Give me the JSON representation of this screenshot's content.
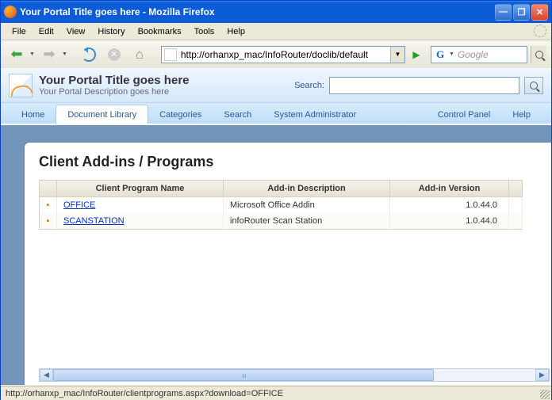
{
  "window": {
    "title": "Your Portal Title goes here - Mozilla Firefox"
  },
  "menu": {
    "items": [
      "File",
      "Edit",
      "View",
      "History",
      "Bookmarks",
      "Tools",
      "Help"
    ]
  },
  "toolbar": {
    "url": "http://orhanxp_mac/InfoRouter/doclib/default",
    "search_engine": "G",
    "search_placeholder": "Google"
  },
  "portal": {
    "title": "Your Portal Title goes here",
    "description": "Your Portal Description goes here",
    "search_label": "Search:"
  },
  "tabs": {
    "items": [
      "Home",
      "Document Library",
      "Categories",
      "Search",
      "System Administrator",
      "Control Panel",
      "Help"
    ],
    "active_index": 1
  },
  "page": {
    "heading": "Client Add-ins / Programs",
    "columns": [
      "Client Program Name",
      "Add-in Description",
      "Add-in Version"
    ],
    "rows": [
      {
        "name": "OFFICE",
        "desc": "Microsoft Office Addin",
        "ver": "1.0.44.0"
      },
      {
        "name": "SCANSTATION",
        "desc": "infoRouter Scan Station",
        "ver": "1.0.44.0"
      }
    ]
  },
  "status": {
    "text": "http://orhanxp_mac/InfoRouter/clientprograms.aspx?download=OFFICE"
  }
}
